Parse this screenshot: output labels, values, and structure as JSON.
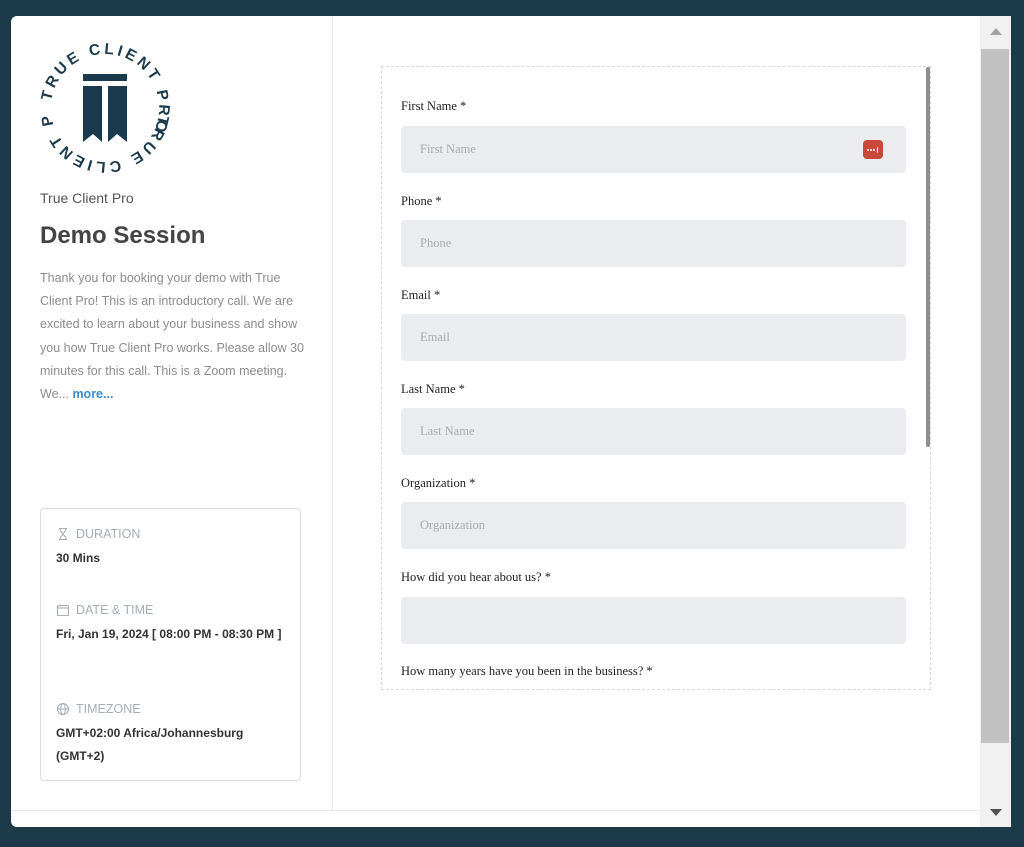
{
  "branding": {
    "logo_ring_text": "TRUE CLIENT PRO",
    "company_name": "True Client Pro"
  },
  "event": {
    "title": "Demo Session",
    "description": "Thank you for booking your demo with True Client Pro! This is an introductory call. We are excited to learn about your business and show you how True Client Pro works. Please allow 30 minutes for this call. This is a Zoom meeting. We...",
    "more_link": "more..."
  },
  "details": {
    "duration_label": "DURATION",
    "duration_value": "30 Mins",
    "datetime_label": "DATE & TIME",
    "datetime_value": "Fri, Jan 19, 2024 [ 08:00 PM - 08:30 PM ]",
    "timezone_label": "TIMEZONE",
    "timezone_value": "GMT+02:00 Africa/Johannesburg (GMT+2)"
  },
  "form": {
    "first_name_label": "First Name *",
    "first_name_placeholder": "First Name",
    "phone_label": "Phone *",
    "phone_placeholder": "Phone",
    "email_label": "Email *",
    "email_placeholder": "Email",
    "last_name_label": "Last Name *",
    "last_name_placeholder": "Last Name",
    "organization_label": "Organization *",
    "organization_placeholder": "Organization",
    "referral_label": "How did you hear about us? *",
    "referral_placeholder": "",
    "years_label": "How many years have you been in the business? *"
  },
  "colors": {
    "background": "#1d3a4b",
    "logo_navy": "#1c3a4d",
    "link": "#3a8cd0",
    "input_bg": "#eaecef",
    "password_icon": "#c9493a"
  }
}
